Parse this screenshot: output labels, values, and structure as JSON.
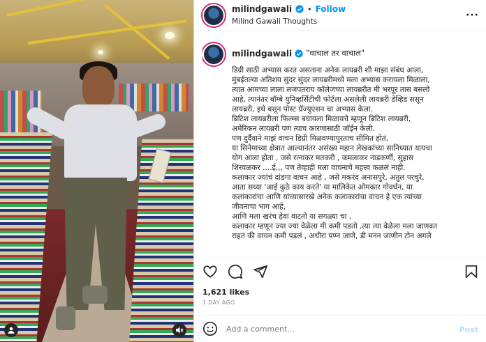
{
  "post": {
    "username": "milindgawali",
    "separator": "•",
    "follow_label": "Follow",
    "subtitle": "Milind Gawali Thoughts",
    "caption_title": "\"वाचाल तर वाचाल\"",
    "caption_lines": [
      "डिग्री साठी अभ्यास करत असताना अनेक लायब्ररी शी माझा संबंध आला,",
      "मुंबईतल्या अतिशय सुंदर सुंदर लायब्ररीमध्ये मला अभ्यास करायला मिळाला,",
      "त्यात आमच्या लाला लजपतराय कॉलेजच्या लायब्ररीत मी भरपूर तास बसलो",
      "आहे, त्यानंतर बॉम्बे युनिव्हर्सिटीची फोर्टला असलेली लायब्ररी डेव्हिड ससून",
      "लायब्ररी, इथे बसून पोस्ट ग्रॅज्युएशन चा अभ्यास केला.",
      "ब्रिटिश लायब्ररीला फिल्म्स बघायला मिळायचे म्हणून ब्रिटिश लायब्ररी,",
      "अमेरिकन लायब्ररी पण त्याच कारणासाठी जॉईन केली.",
      "पण दुर्दैवाने माझं वाचन डिग्री मिळवण्यापुरताच सीमित होतं,",
      "या सिनेमाच्या क्षेत्रात आल्यानंतर असंख्य महान लेखकांच्या सानिध्यात यायचा",
      "योग आला होता , जसे रत्नाकर मतकरी , कमलाकर नाडकर्णी, सुहास",
      "शिरवळकर ....ई,,, पण तेव्हाही मला वाचनाचे महत्त्व कळलं नाही.",
      "कलाकार ज्यांचं दांडगा वाचन आहे , जसे मकरंद अनासपुरे, अतुल परचुरे,",
      "आता सध्या 'आई कुठे काय करते' या मालिकेत ओमकार गोवर्धन, या",
      "कलाकारांचा आणि यांच्यासारखे अनेक कलाकारांचा वाचन हे एक त्यांच्या",
      "जीवनाचा भाग आहे,",
      "आणि मला खरंच हेवा वाटतो या सगळ्या चा ,",
      "कलाकार म्हणून ज्या ज्या वेळेला मी कमी पडतो ,त्या त्या वेळेला मला जाणवत",
      "राहतं की वाचन कमी पडलं , अधीरा पण्न जाणे, डी मनन जाणीन टोन अगले"
    ],
    "likes": "1,621 likes",
    "time_ago": "1 DAY AGO",
    "comment_placeholder": "Add a comment...",
    "post_label": "Post"
  },
  "icons": {
    "header_more": "more-icon",
    "verified": "verified-badge-icon",
    "like": "heart-icon",
    "comment": "comment-icon",
    "share": "send-icon",
    "save": "bookmark-icon",
    "emoji": "emoji-icon",
    "photo_user": "user-tag-icon",
    "photo_mute": "mute-icon"
  },
  "colors": {
    "accent": "#0095f6",
    "verified": "#0095f6",
    "post_disabled": "#b2dffc",
    "muted_text": "#8e8e8e"
  }
}
